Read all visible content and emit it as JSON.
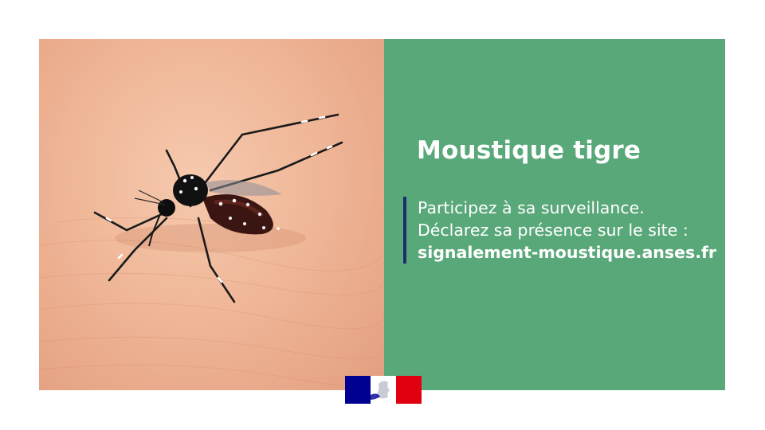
{
  "panel": {
    "title": "Moustique tigre",
    "line1": "Participez à sa surveillance.",
    "line2": "Déclarez sa présence sur le site :",
    "site": "signalement-moustique.anses.fr"
  },
  "colors": {
    "panel_green": "#59a879",
    "accent_bar": "#1f2d6b",
    "flag_blue": "#000091",
    "flag_red": "#e1000f"
  },
  "images": {
    "photo": "tiger-mosquito-on-skin",
    "logo": "republique-francaise-marianne-logo"
  }
}
